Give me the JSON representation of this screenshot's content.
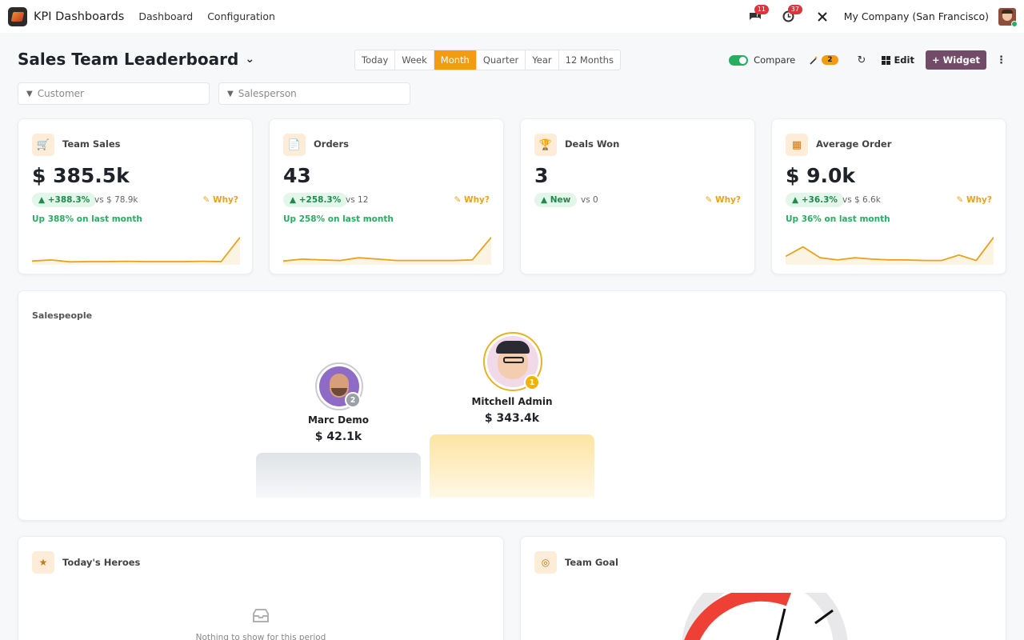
{
  "topbar": {
    "app_title": "KPI Dashboards",
    "nav": [
      "Dashboard",
      "Configuration"
    ],
    "messages_count": "11",
    "activities_count": "37",
    "company": "My Company (San Francisco)"
  },
  "header": {
    "title": "Sales Team Leaderboard",
    "periods": [
      "Today",
      "Week",
      "Month",
      "Quarter",
      "Year",
      "12 Months"
    ],
    "active_period": "Month",
    "compare_label": "Compare",
    "compare_on": true,
    "insights_count": "2",
    "edit_label": "Edit",
    "widget_label": "+ Widget"
  },
  "filters": {
    "customer_placeholder": "Customer",
    "salesperson_placeholder": "Salesperson"
  },
  "kpis": [
    {
      "title": "Team Sales",
      "value": "$ 385.5k",
      "delta": "▲ +388.3%",
      "vs": "vs $ 78.9k",
      "why": "Why?",
      "trend": "Up 388% on last month",
      "spark": [
        0.08,
        0.12,
        0.05,
        0.06,
        0.06,
        0.07,
        0.06,
        0.06,
        0.06,
        0.07,
        0.06,
        0.95
      ],
      "icon": "cart-icon"
    },
    {
      "title": "Orders",
      "value": "43",
      "delta": "▲ +258.3%",
      "vs": "vs 12",
      "why": "Why?",
      "trend": "Up 258% on last month",
      "spark": [
        0.08,
        0.15,
        0.12,
        0.1,
        0.2,
        0.15,
        0.1,
        0.1,
        0.1,
        0.1,
        0.12,
        0.95
      ],
      "icon": "document-icon"
    },
    {
      "title": "Deals Won",
      "value": "3",
      "delta": "▲ New",
      "vs": "vs 0",
      "why": "Why?",
      "trend": "",
      "spark": [],
      "icon": "trophy-icon"
    },
    {
      "title": "Average Order",
      "value": "$ 9.0k",
      "delta": "▲ +36.3%",
      "vs": "vs $ 6.6k",
      "why": "Why?",
      "trend": "Up 36% on last month",
      "spark": [
        0.25,
        0.6,
        0.2,
        0.12,
        0.2,
        0.15,
        0.12,
        0.12,
        0.1,
        0.1,
        0.3,
        0.1,
        0.95
      ],
      "icon": "calculator-icon"
    }
  ],
  "salespeople": {
    "title": "Salespeople",
    "podium": [
      {
        "rank": "2",
        "name": "Marc Demo",
        "amount": "$ 42.1k",
        "value": 42.1
      },
      {
        "rank": "1",
        "name": "Mitchell Admin",
        "amount": "$ 343.4k",
        "value": 343.4
      }
    ]
  },
  "heroes": {
    "title": "Today's Heroes",
    "empty_text": "Nothing to show for this period"
  },
  "goal": {
    "title": "Team Goal"
  },
  "colors": {
    "accent": "#f39c12",
    "brand": "#714b67",
    "positive": "#27ae60",
    "spark": "#e8a21b"
  }
}
